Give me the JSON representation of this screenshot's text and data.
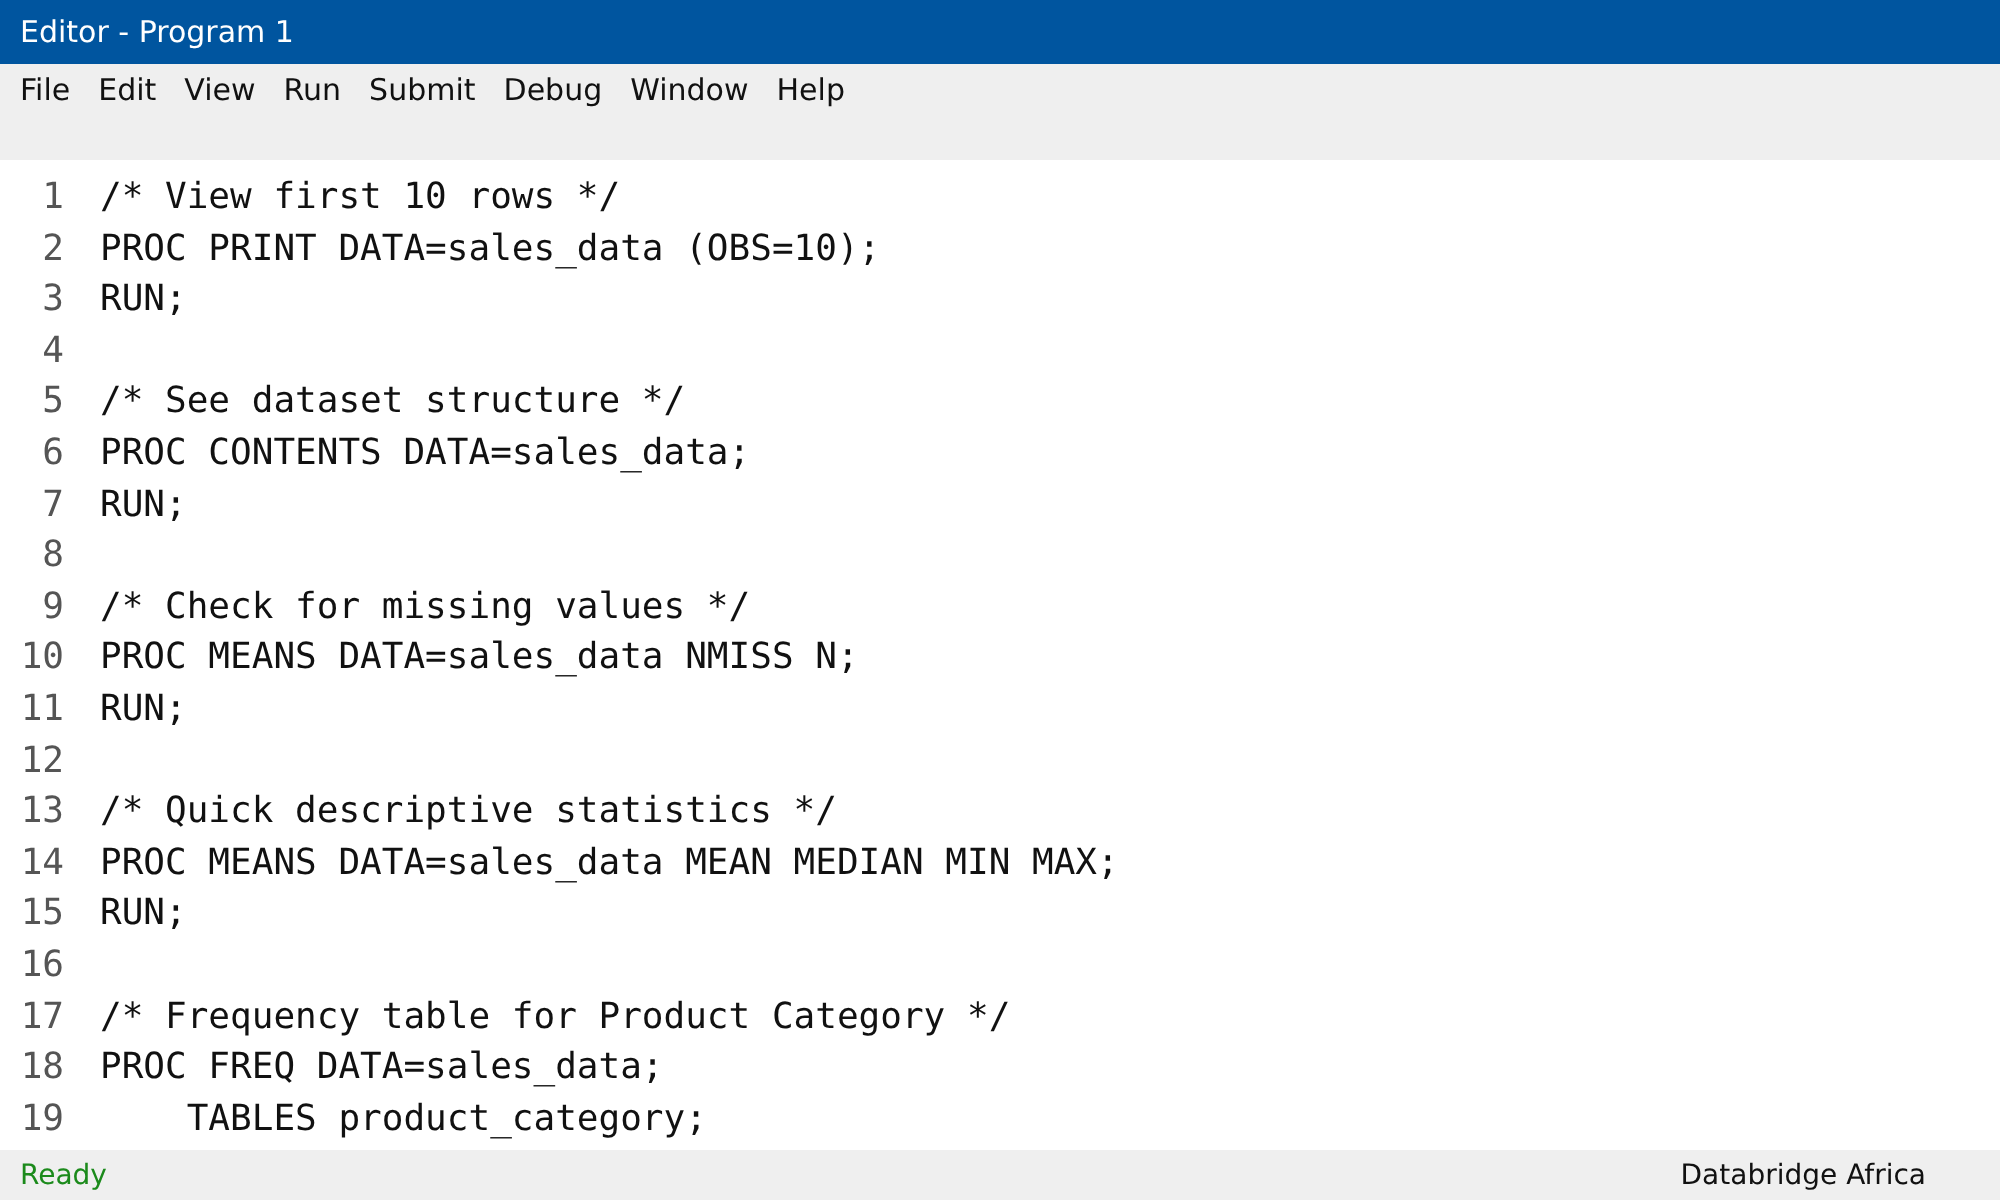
{
  "window": {
    "title": "Editor - Program 1"
  },
  "menu": [
    "File",
    "Edit",
    "View",
    "Run",
    "Submit",
    "Debug",
    "Window",
    "Help"
  ],
  "editor": {
    "lines": [
      {
        "number": "1",
        "text": "/* View first 10 rows */"
      },
      {
        "number": "2",
        "text": "PROC PRINT DATA=sales_data (OBS=10);"
      },
      {
        "number": "3",
        "text": "RUN;"
      },
      {
        "number": "4"
      },
      {
        "number": "5",
        "text": "/* See dataset structure */"
      },
      {
        "number": "6",
        "text": "PROC CONTENTS DATA=sales_data;"
      },
      {
        "number": "7",
        "text": "RUN;"
      },
      {
        "number": "8"
      },
      {
        "number": "9",
        "text": "/* Check for missing values */"
      },
      {
        "number": "10",
        "text": "PROC MEANS DATA=sales_data NMISS N;"
      },
      {
        "number": "11",
        "text": "RUN;"
      },
      {
        "number": "12"
      },
      {
        "number": "13",
        "text": "/* Quick descriptive statistics */"
      },
      {
        "number": "14",
        "text": "PROC MEANS DATA=sales_data MEAN MEDIAN MIN MAX;"
      },
      {
        "number": "15",
        "text": "RUN;"
      },
      {
        "number": "16"
      },
      {
        "number": "17",
        "text": "/* Frequency table for Product Category */"
      },
      {
        "number": "18",
        "text": "PROC FREQ DATA=sales_data;"
      },
      {
        "number": "19",
        "text": "    TABLES product_category;"
      }
    ]
  },
  "status_bar": {
    "status": "Ready",
    "brand": "Databridge Africa"
  }
}
